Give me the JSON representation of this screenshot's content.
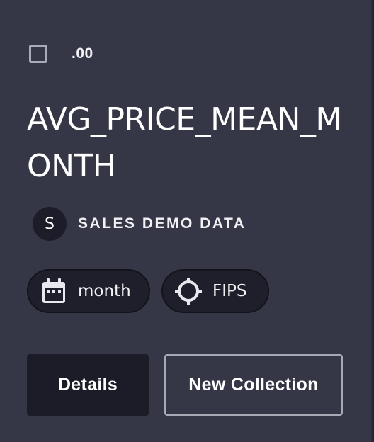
{
  "card": {
    "format_label": ".00",
    "title": "AVG_PRICE_MEAN_MONTH",
    "source": {
      "avatar_letter": "S",
      "label": "SALES DEMO DATA"
    },
    "chips": [
      {
        "icon": "calendar-icon",
        "label": "month"
      },
      {
        "icon": "crosshair-icon",
        "label": "FIPS"
      }
    ],
    "buttons": {
      "details_label": "Details",
      "new_collection_label": "New Collection"
    }
  },
  "colors": {
    "card_bg": "#353746",
    "dark_surface": "#1b1c28",
    "text": "#ffffff",
    "outline": "#a7a9b4"
  }
}
